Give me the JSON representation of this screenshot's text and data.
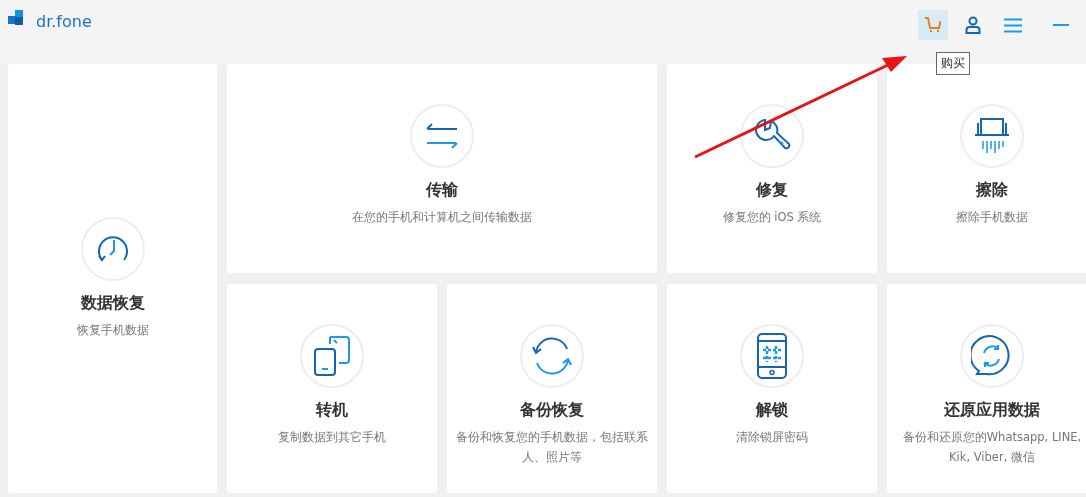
{
  "header": {
    "logo": "dr.fone",
    "buttons": [
      {
        "kind": "cart",
        "selected": true
      },
      {
        "kind": "user",
        "selected": false
      },
      {
        "kind": "menu",
        "selected": false
      },
      {
        "kind": "minimize",
        "selected": false
      }
    ],
    "tooltip": "购买"
  },
  "annotation": {
    "kind": "arrow"
  },
  "cards": [
    {
      "title": "数据恢复",
      "description": "恢复手机数据"
    },
    {
      "title": "传输",
      "description": "在您的手机和计算机之间传输数据"
    },
    {
      "title": "修复",
      "description": "修复您的 iOS 系统"
    },
    {
      "title": "擦除",
      "description": "擦除手机数据"
    },
    {
      "title": "转机",
      "description": "复制数据到其它手机"
    },
    {
      "title": "备份恢复",
      "description": "备份和恢复您的手机数据，包括联系人、照片等"
    },
    {
      "title": "解锁",
      "description": "清除锁屏密码"
    },
    {
      "title": "还原应用数据",
      "description": "备份和还原您的Whatsapp, LINE, Kik, Viber, 微信"
    }
  ]
}
